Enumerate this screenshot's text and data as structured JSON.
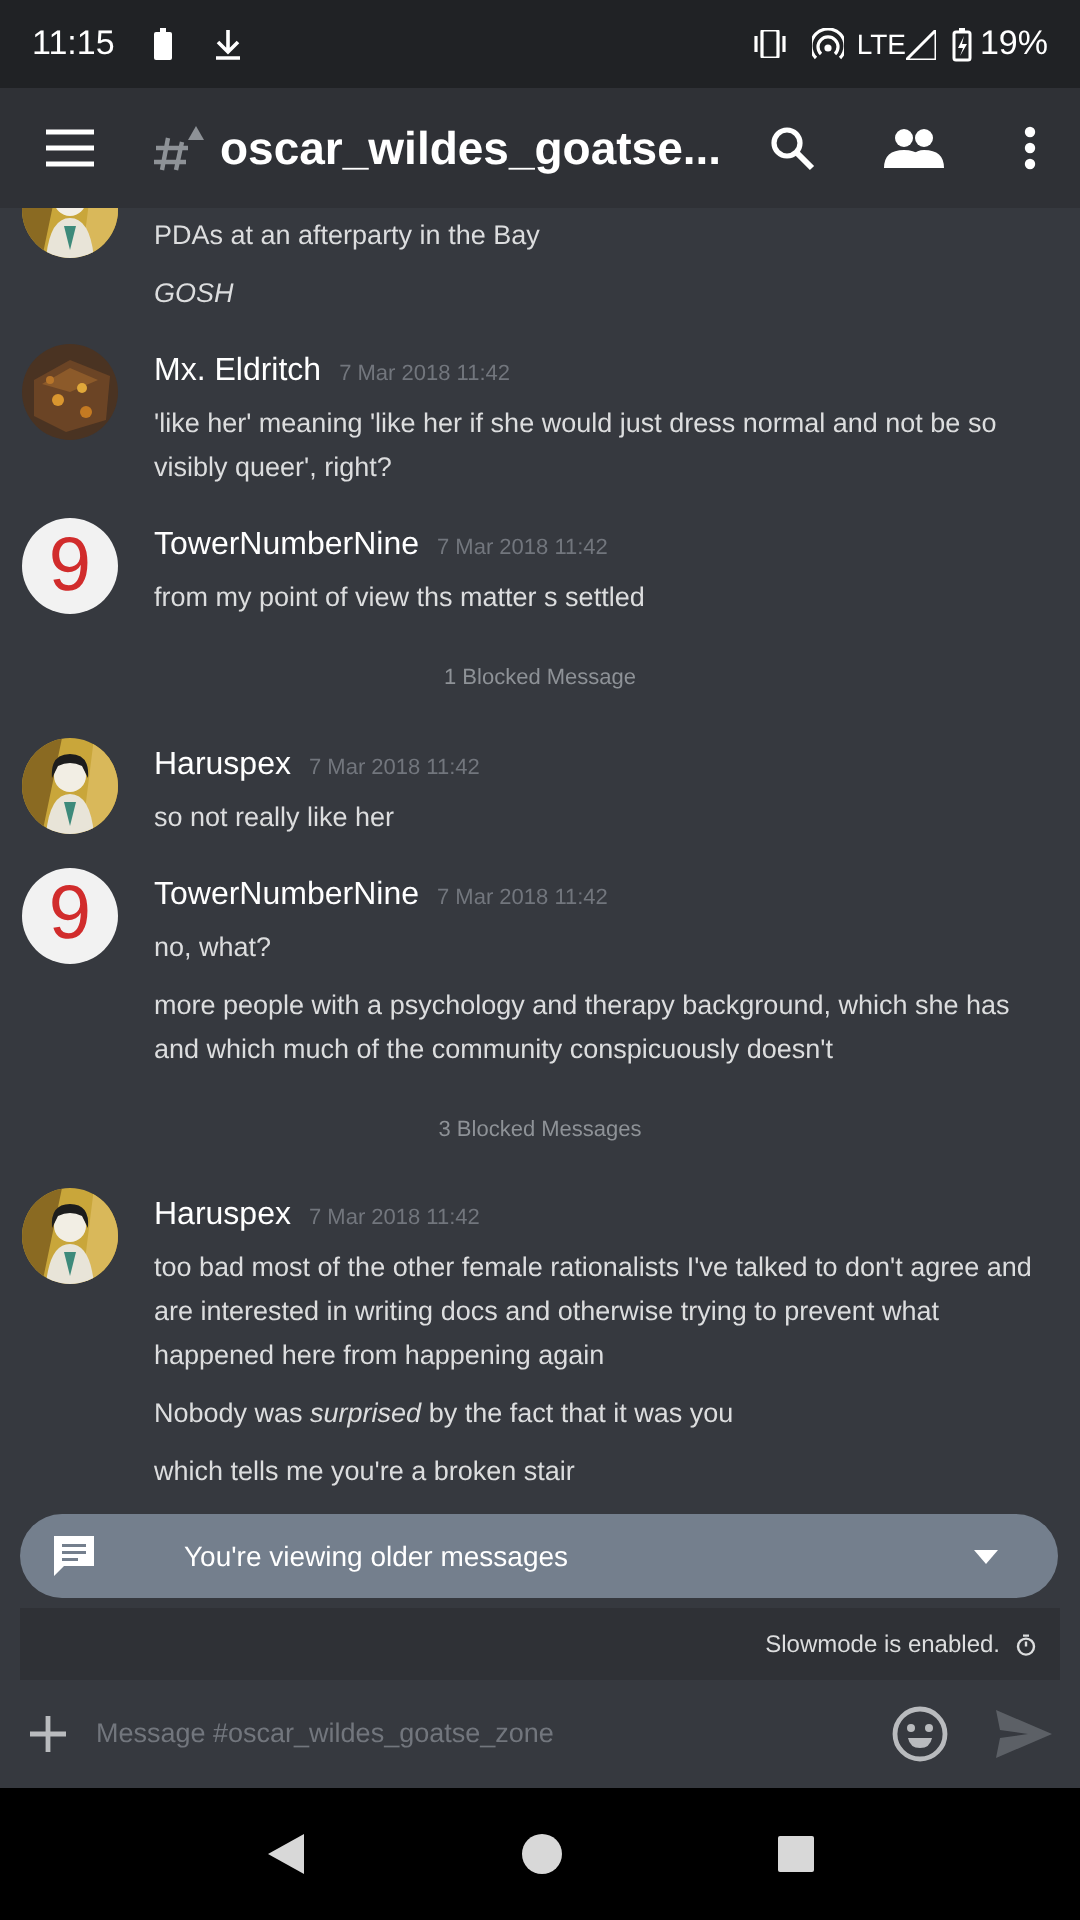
{
  "status_bar": {
    "time": "11:15",
    "network": "LTE",
    "battery": "19%"
  },
  "header": {
    "channel": "oscar_wildes_goatse..."
  },
  "messages": [
    {
      "kind": "message",
      "avatar": {
        "kind": "picture"
      },
      "lines": [
        "PDAs at an afterparty in the Bay",
        "*GOSH*"
      ]
    },
    {
      "kind": "message",
      "avatar": {
        "kind": "picture"
      },
      "author": "Mx. Eldritch",
      "timestamp": "7 Mar 2018 11:42",
      "lines": [
        "'like her' meaning 'like her if she would just dress normal and not be so visibly queer', right?"
      ]
    },
    {
      "kind": "message",
      "avatar": {
        "kind": "letter",
        "text": "9"
      },
      "author": "TowerNumberNine",
      "timestamp": "7 Mar 2018 11:42",
      "lines": [
        "from my point of view ths matter s settled"
      ]
    },
    {
      "kind": "blocked",
      "text": "1 Blocked Message"
    },
    {
      "kind": "message",
      "avatar": {
        "kind": "picture"
      },
      "author": "Haruspex",
      "timestamp": "7 Mar 2018 11:42",
      "lines": [
        "so not really like her"
      ]
    },
    {
      "kind": "message",
      "avatar": {
        "kind": "letter",
        "text": "9"
      },
      "author": "TowerNumberNine",
      "timestamp": "7 Mar 2018 11:42",
      "lines": [
        "no, what?",
        "more people with a psychology and therapy background, which she has and which much of the community conspicuously doesn't"
      ]
    },
    {
      "kind": "blocked",
      "text": "3 Blocked Messages"
    },
    {
      "kind": "message",
      "avatar": {
        "kind": "picture"
      },
      "author": "Haruspex",
      "timestamp": "7 Mar 2018 11:42",
      "lines": [
        "too bad most of the other female rationalists I've talked to don't agree and are interested in writing docs and otherwise trying to prevent what happened here from happening again",
        "Nobody was *surprised* by the fact that it was you",
        "which tells me you're a broken stair"
      ]
    }
  ],
  "banner": {
    "text": "You're viewing older messages"
  },
  "slowmode": {
    "text": "Slowmode is enabled."
  },
  "composer": {
    "placeholder": "Message #oscar_wildes_goatse_zone"
  }
}
